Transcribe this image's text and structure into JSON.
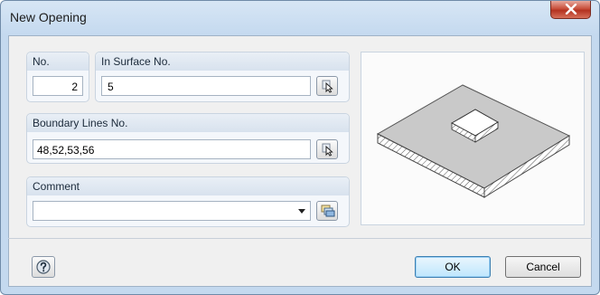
{
  "window": {
    "title": "New Opening",
    "close_icon": "close-icon"
  },
  "fields": {
    "no": {
      "label": "No.",
      "value": "2"
    },
    "in_surface": {
      "label": "In Surface No.",
      "value": "5",
      "pick_icon": "pick-cursor-icon"
    },
    "boundary": {
      "label": "Boundary Lines No.",
      "value": "48,52,53,56",
      "pick_icon": "pick-cursor-icon"
    },
    "comment": {
      "label": "Comment",
      "value": "",
      "dropdown_icon": "chevron-down-icon",
      "library_icon": "comment-library-icon"
    }
  },
  "preview": {
    "icon": "opening-in-surface-illustration"
  },
  "buttons": {
    "help_icon": "help-icon",
    "ok": "OK",
    "cancel": "Cancel"
  },
  "colors": {
    "title_bar": "#c4d9ef",
    "close_button": "#c8503c",
    "default_button": "#bee6fd"
  }
}
